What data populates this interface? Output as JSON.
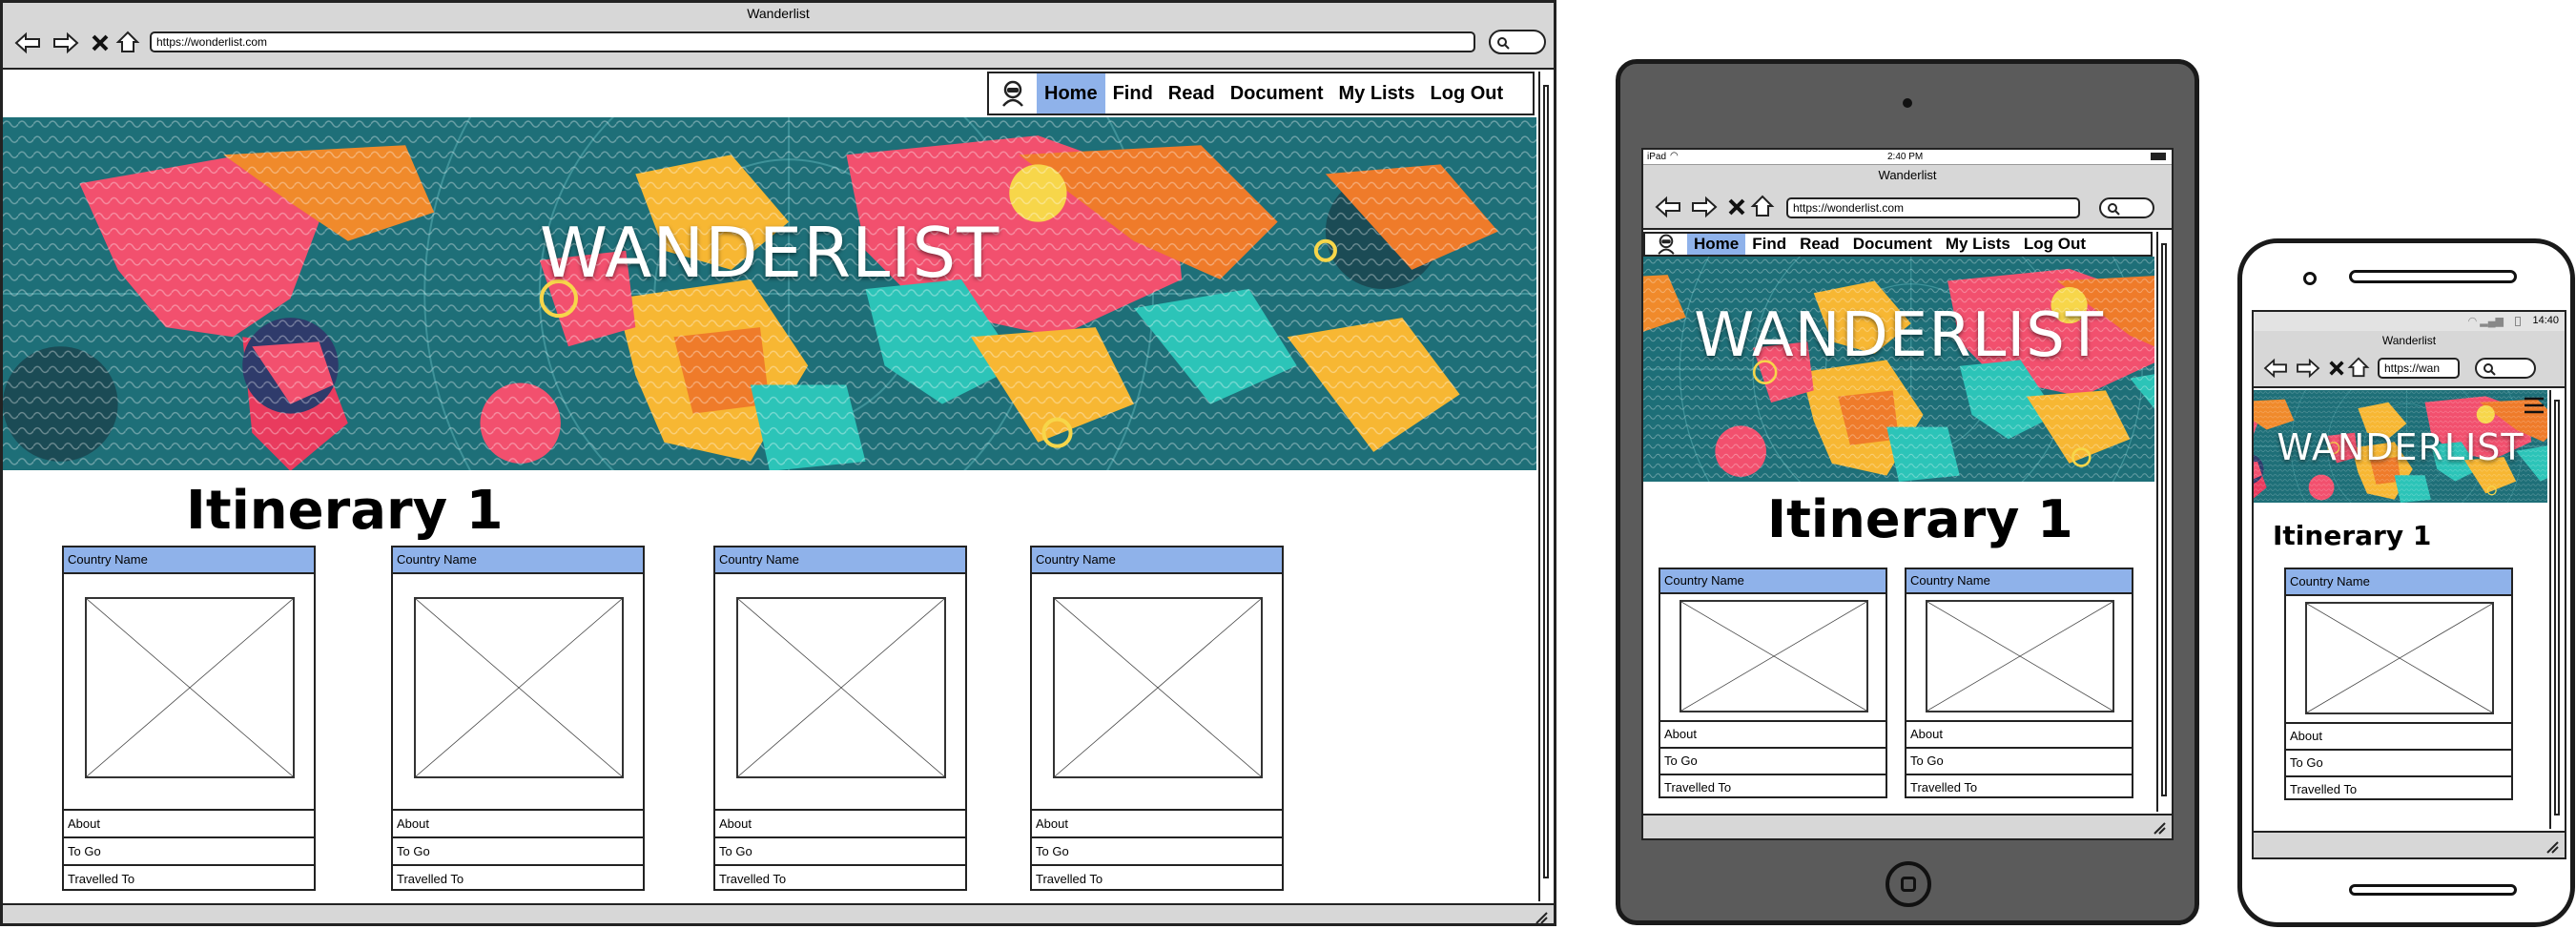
{
  "site": {
    "window_title": "Wanderlist",
    "url": "https://wonderlist.com",
    "url_short": "https://wan",
    "banner_title": "WANDERLIST"
  },
  "nav": {
    "items": [
      "Home",
      "Find",
      "Read",
      "Document",
      "My Lists",
      "Log Out"
    ],
    "active": "Home"
  },
  "itinerary": {
    "heading": "Itinerary 1",
    "cards": [
      {
        "header": "Country Name",
        "rows": [
          "About",
          "To Go",
          "Travelled To"
        ]
      },
      {
        "header": "Country Name",
        "rows": [
          "About",
          "To Go",
          "Travelled To"
        ]
      },
      {
        "header": "Country Name",
        "rows": [
          "About",
          "To Go",
          "Travelled To"
        ]
      },
      {
        "header": "Country Name",
        "rows": [
          "About",
          "To Go",
          "Travelled To"
        ]
      }
    ]
  },
  "tablet": {
    "status_left": "iPad",
    "status_time": "2:40 PM"
  },
  "phone": {
    "status_time": "14:40"
  },
  "colors": {
    "accent": "#8fb2ea",
    "frame": "#1a1a1a",
    "chrome": "#d7d7d7",
    "tablet_body": "#5b5b5b"
  },
  "icons": [
    "back-arrow-icon",
    "forward-arrow-icon",
    "stop-icon",
    "home-icon",
    "search-icon",
    "user-avatar-icon",
    "hamburger-menu-icon",
    "resize-grip-icon",
    "wifi-icon",
    "battery-icon",
    "signal-icon"
  ]
}
